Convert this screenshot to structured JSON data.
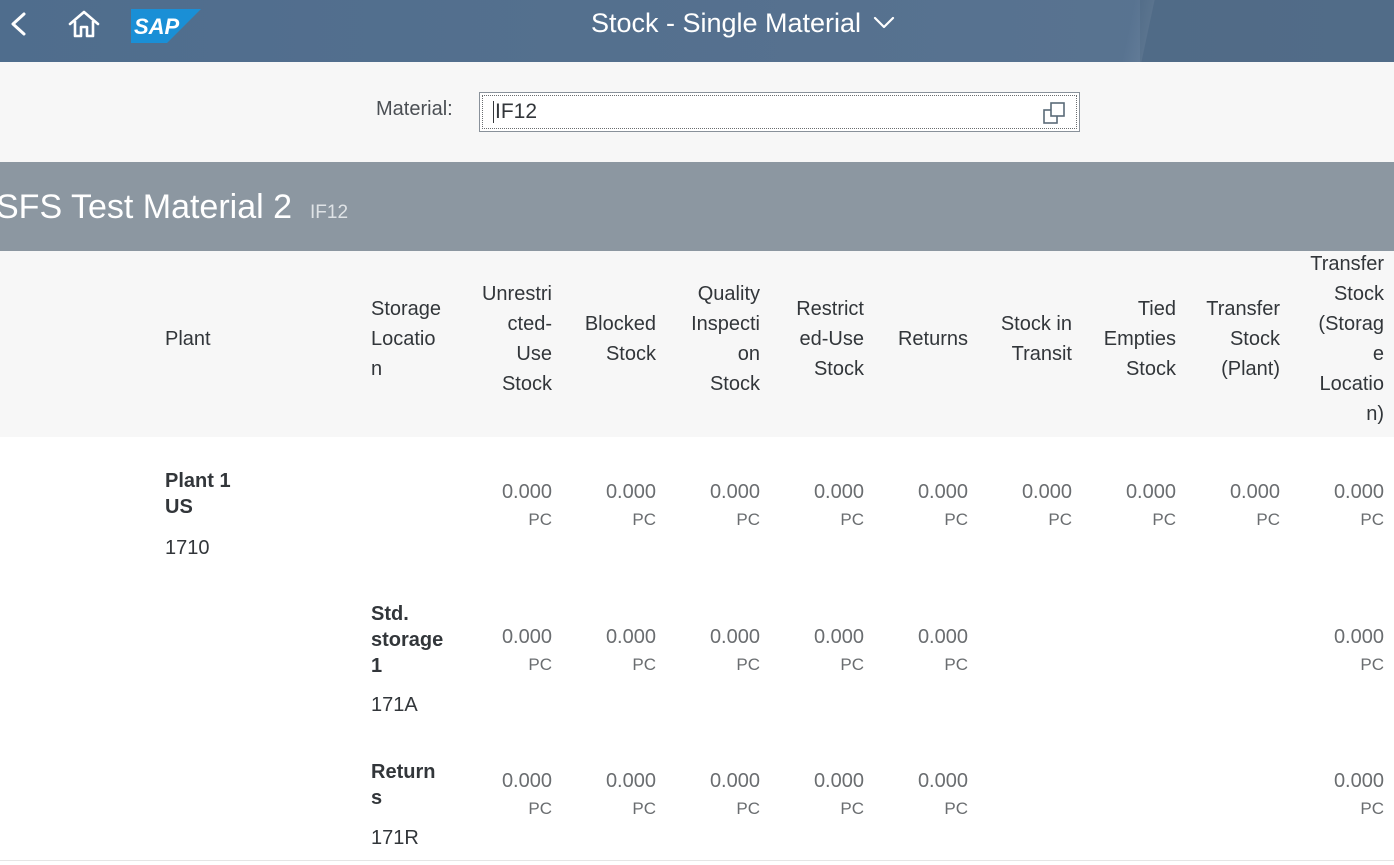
{
  "shell": {
    "title": "Stock - Single Material"
  },
  "selection": {
    "label": "Material:",
    "value": "IF12"
  },
  "object": {
    "title": "SFS Test Material 2",
    "id": "IF12"
  },
  "table": {
    "headers": {
      "plant": "Plant",
      "storage": [
        "Storage",
        "Locatio",
        "n"
      ],
      "unrestricted": [
        "Unrestri",
        "cted-",
        "Use",
        "Stock"
      ],
      "blocked": [
        "Blocked",
        "Stock"
      ],
      "quality": [
        "Quality",
        "Inspecti",
        "on",
        "Stock"
      ],
      "restricted": [
        "Restrict",
        "ed-Use",
        "Stock"
      ],
      "returns": [
        "Returns"
      ],
      "transit": [
        "Stock in",
        "Transit"
      ],
      "tied": [
        "Tied",
        "Empties",
        "Stock"
      ],
      "transfer_plant": [
        "Transfer",
        "Stock",
        "(Plant)"
      ],
      "transfer_sloc": [
        "Transfer",
        "Stock",
        "(Storag",
        "e",
        "Locatio",
        "n)"
      ]
    },
    "rows": [
      {
        "title_lines": [
          "Plant 1",
          "US"
        ],
        "code": "1710",
        "values": {
          "unrestricted": "0.000",
          "blocked": "0.000",
          "quality": "0.000",
          "restricted": "0.000",
          "returns": "0.000",
          "transit": "0.000",
          "tied": "0.000",
          "transfer_plant": "0.000",
          "transfer_sloc": "0.000"
        },
        "unit": "PC"
      },
      {
        "title_lines": [
          "Std.",
          "storage",
          "1"
        ],
        "code": "171A",
        "values": {
          "unrestricted": "0.000",
          "blocked": "0.000",
          "quality": "0.000",
          "restricted": "0.000",
          "returns": "0.000",
          "transfer_sloc": "0.000"
        },
        "unit": "PC"
      },
      {
        "title_lines": [
          "Return",
          "s"
        ],
        "code": "171R",
        "values": {
          "unrestricted": "0.000",
          "blocked": "0.000",
          "quality": "0.000",
          "restricted": "0.000",
          "returns": "0.000",
          "transfer_sloc": "0.000"
        },
        "unit": "PC"
      }
    ]
  },
  "colors": {
    "shell": "#56718f",
    "object_header": "#8c97a1",
    "table_header_bg": "#f7f7f7"
  },
  "icons": {
    "back": "back-arrow-icon",
    "home": "home-icon",
    "logo": "sap-logo",
    "title_menu": "chevron-down-icon",
    "value_help": "value-help-icon"
  }
}
